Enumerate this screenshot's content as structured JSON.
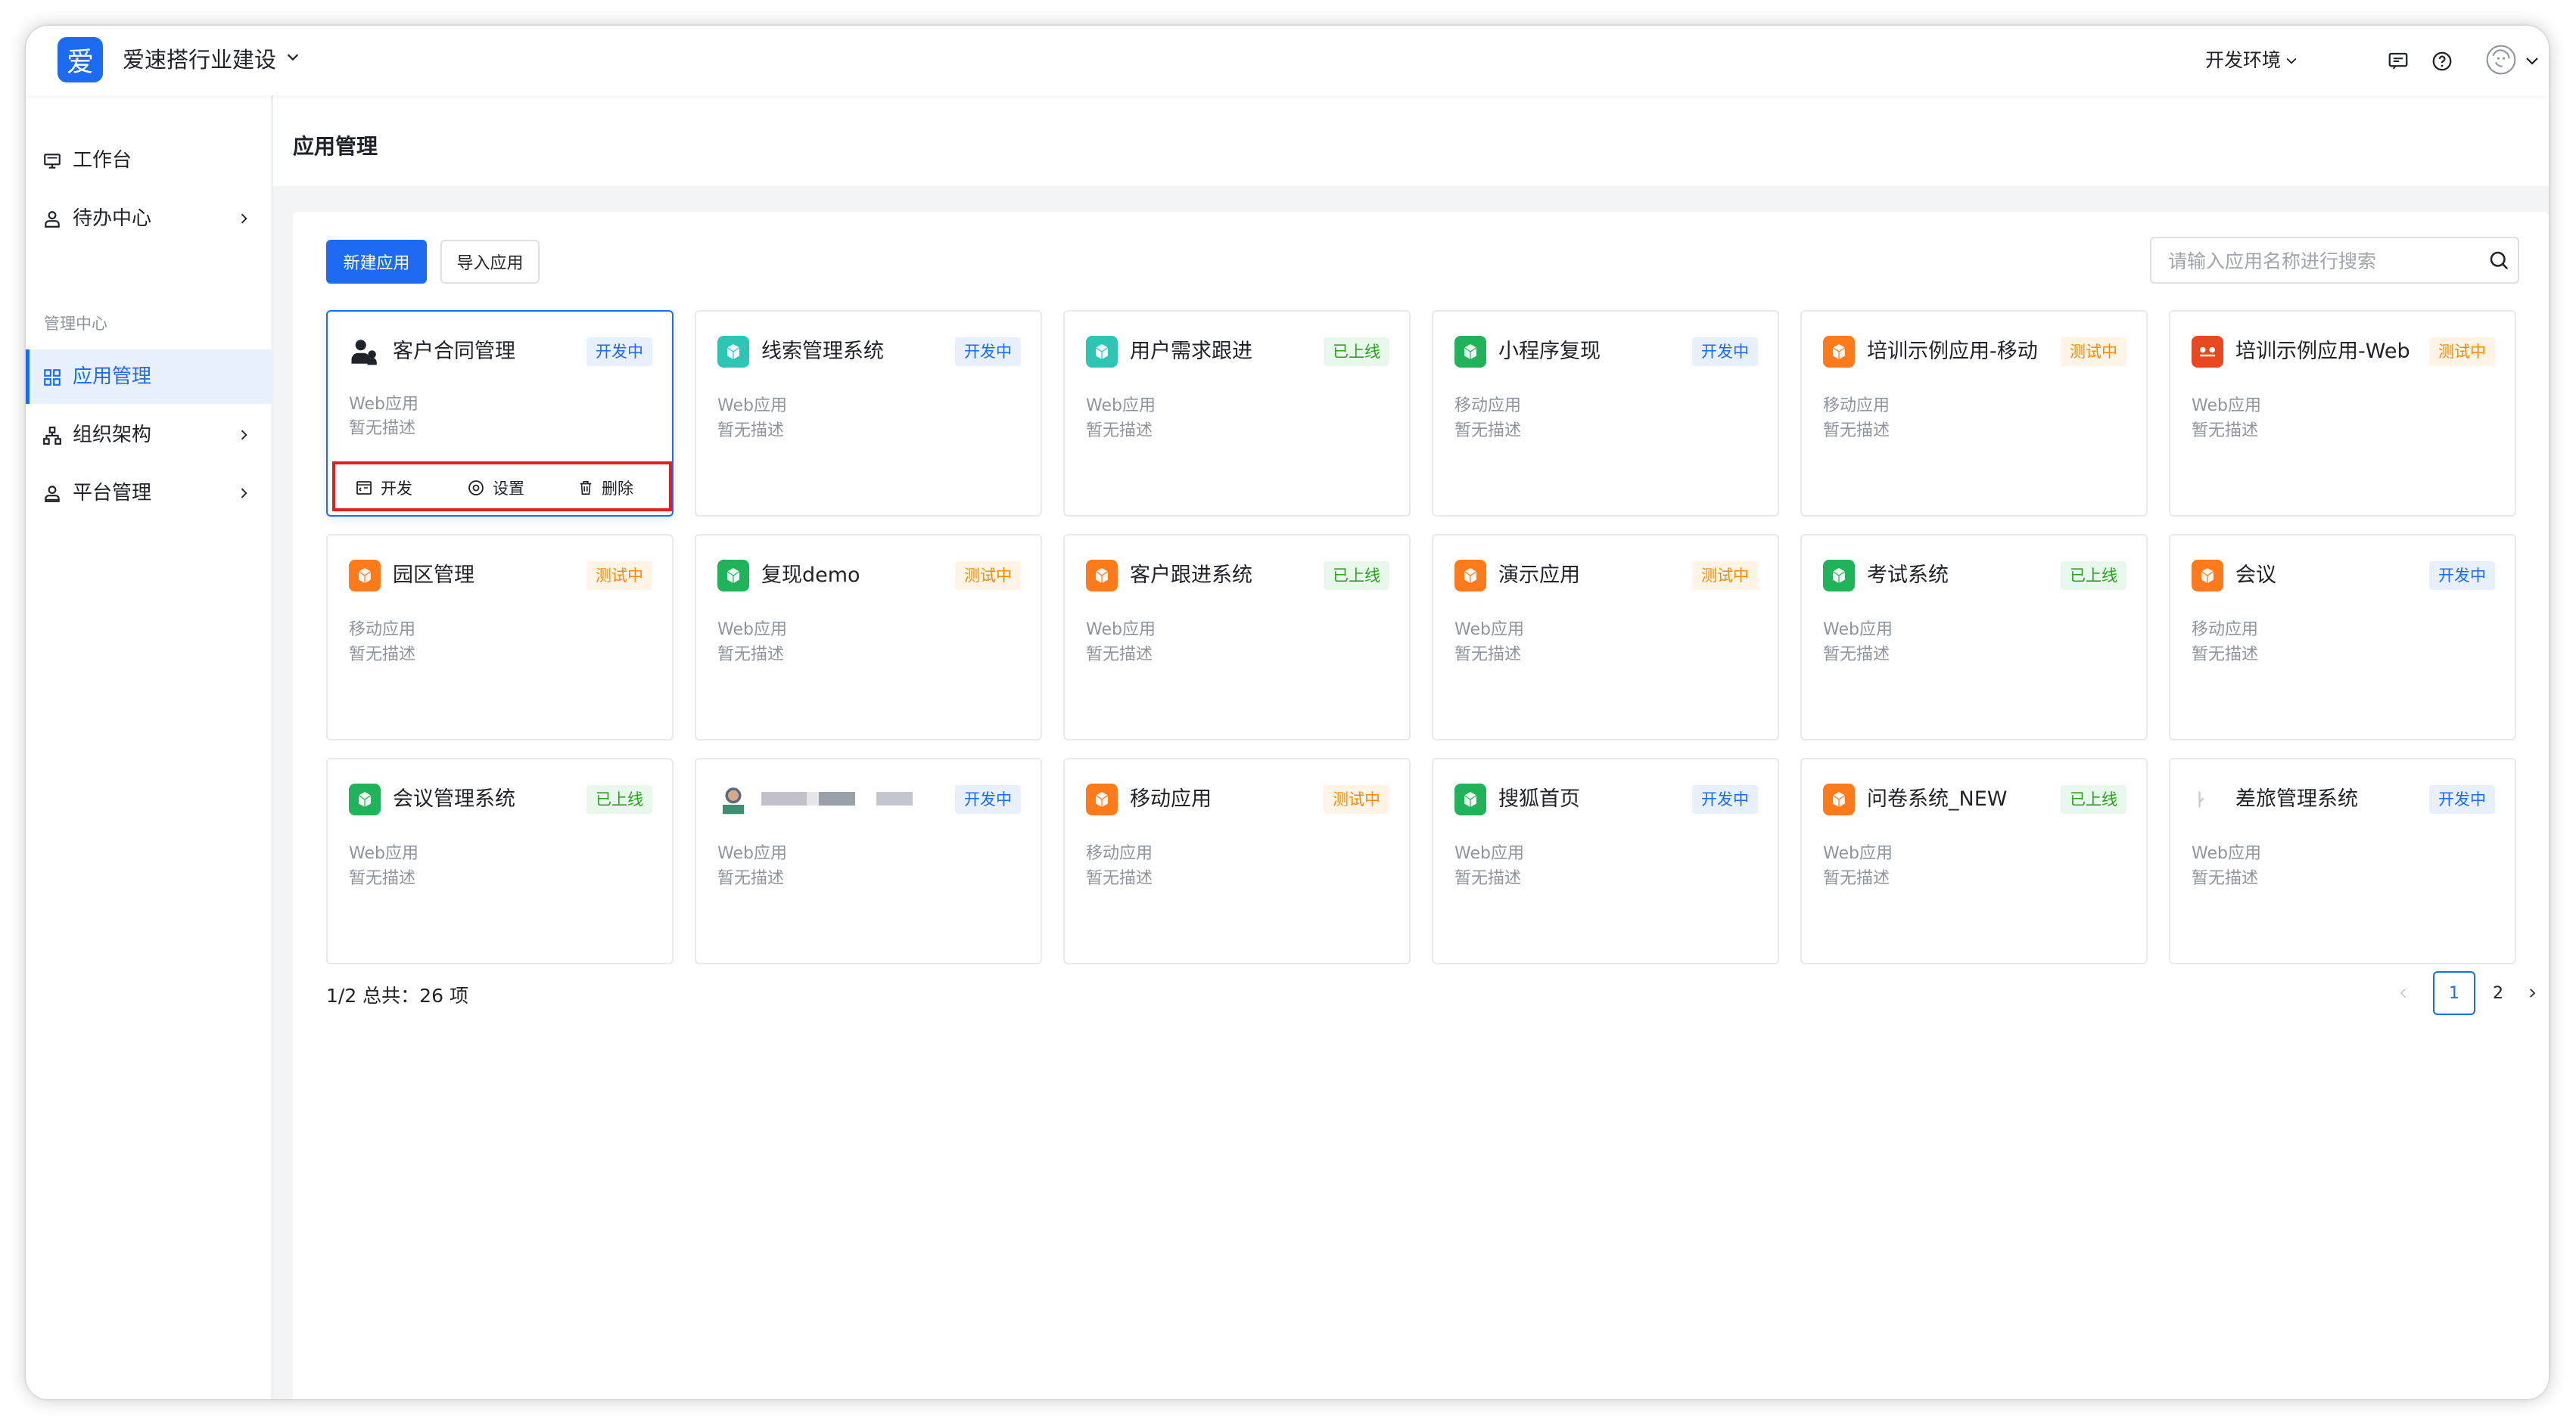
{
  "topbar": {
    "logo_text": "爱",
    "app_name": "爱速搭行业建设",
    "env_label": "开发环境"
  },
  "sidebar": {
    "items": [
      {
        "label": "工作台",
        "icon": "monitor-icon"
      },
      {
        "label": "待办中心",
        "icon": "user-task-icon"
      },
      {
        "label": "应用管理",
        "icon": "grid-icon"
      },
      {
        "label": "组织架构",
        "icon": "org-icon"
      },
      {
        "label": "平台管理",
        "icon": "user-admin-icon"
      }
    ],
    "group_label": "管理中心"
  },
  "main": {
    "title": "应用管理",
    "new_app_button": "新建应用",
    "import_app_button": "导入应用",
    "search_placeholder": "请输入应用名称进行搜索"
  },
  "apps": [
    {
      "name": "客户合同管理",
      "status": "开发中",
      "type": "Web应用",
      "desc": "暂无描述",
      "icon_color": "#1f2329"
    },
    {
      "name": "线索管理系统",
      "status": "开发中",
      "type": "Web应用",
      "desc": "暂无描述",
      "icon_color": "#2ec5b5"
    },
    {
      "name": "用户需求跟进",
      "status": "已上线",
      "type": "Web应用",
      "desc": "暂无描述",
      "icon_color": "#2ec5b5"
    },
    {
      "name": "小程序复现",
      "status": "开发中",
      "type": "移动应用",
      "desc": "暂无描述",
      "icon_color": "#21b35a"
    },
    {
      "name": "培训示例应用-移动",
      "status": "测试中",
      "type": "移动应用",
      "desc": "暂无描述",
      "icon_color": "#ff7a1a"
    },
    {
      "name": "培训示例应用-Web",
      "status": "测试中",
      "type": "Web应用",
      "desc": "暂无描述",
      "icon_color": "#e8481f"
    },
    {
      "name": "园区管理",
      "status": "测试中",
      "type": "移动应用",
      "desc": "暂无描述",
      "icon_color": "#ff7a1a"
    },
    {
      "name": "复现demo",
      "status": "测试中",
      "type": "Web应用",
      "desc": "暂无描述",
      "icon_color": "#21b35a"
    },
    {
      "name": "客户跟进系统",
      "status": "已上线",
      "type": "Web应用",
      "desc": "暂无描述",
      "icon_color": "#ff7a1a"
    },
    {
      "name": "演示应用",
      "status": "测试中",
      "type": "Web应用",
      "desc": "暂无描述",
      "icon_color": "#ff7a1a"
    },
    {
      "name": "考试系统",
      "status": "已上线",
      "type": "Web应用",
      "desc": "暂无描述",
      "icon_color": "#21b35a"
    },
    {
      "name": "会议",
      "status": "开发中",
      "type": "移动应用",
      "desc": "暂无描述",
      "icon_color": "#ff7a1a"
    },
    {
      "name": "会议管理系统",
      "status": "已上线",
      "type": "Web应用",
      "desc": "暂无描述",
      "icon_color": "#21b35a"
    },
    {
      "name": "",
      "status": "开发中",
      "type": "Web应用",
      "desc": "暂无描述",
      "icon_color": "#5a6b7a"
    },
    {
      "name": "移动应用",
      "status": "测试中",
      "type": "移动应用",
      "desc": "暂无描述",
      "icon_color": "#ff7a1a"
    },
    {
      "name": "搜狐首页",
      "status": "开发中",
      "type": "Web应用",
      "desc": "暂无描述",
      "icon_color": "#21b35a"
    },
    {
      "name": "问卷系统_NEW",
      "status": "已上线",
      "type": "Web应用",
      "desc": "暂无描述",
      "icon_color": "#ff7a1a"
    },
    {
      "name": "差旅管理系统",
      "status": "开发中",
      "type": "Web应用",
      "desc": "暂无描述",
      "icon_color": "#d0d3d8"
    }
  ],
  "card_actions": {
    "develop": "开发",
    "settings": "设置",
    "delete": "删除"
  },
  "pagination": {
    "summary": "1/2 总共：26 项",
    "pages": [
      "1",
      "2"
    ],
    "current": "1"
  },
  "colors": {
    "primary": "#1d6bf2",
    "dev_badge": "#1d6bf2",
    "test_badge": "#ff8a00",
    "online_badge": "#2ea121",
    "highlight_box": "#e02020"
  }
}
